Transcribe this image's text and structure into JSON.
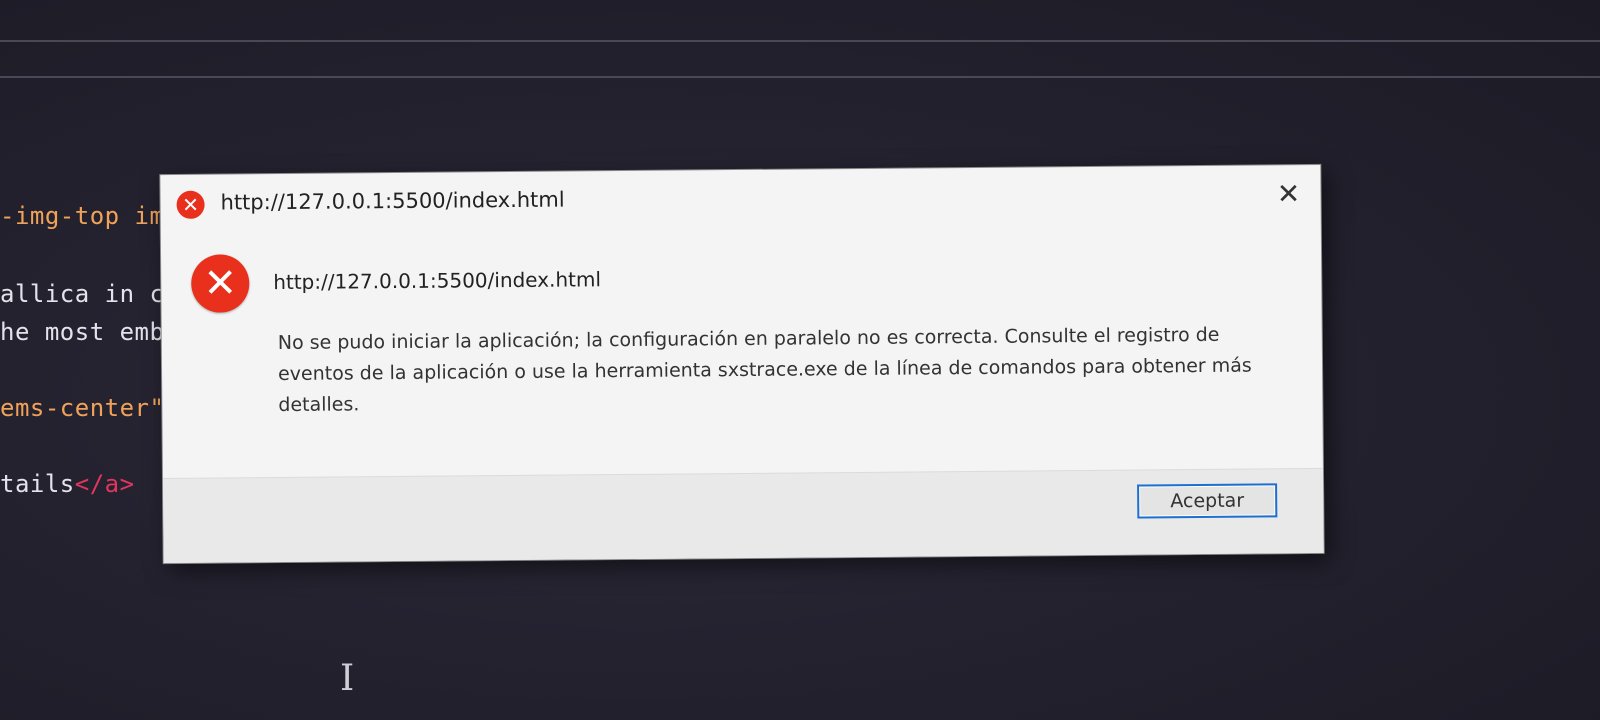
{
  "editor": {
    "lines": [
      {
        "text": "-img-top im",
        "style": "orange"
      },
      {
        "text": "allica in c",
        "style": "plain"
      },
      {
        "text": "he most emb",
        "style": "plain"
      },
      {
        "text": "ems-center\">",
        "style": "orange"
      },
      {
        "text_plain": "tails",
        "text_tag": "</a>"
      }
    ]
  },
  "dialog": {
    "title": "http://127.0.0.1:5500/index.html",
    "title_icon": "error-icon",
    "close_label": "✕",
    "heading": "http://127.0.0.1:5500/index.html",
    "message": "No se pudo iniciar la aplicación; la configuración en paralelo no es correcta. Consulte el registro de eventos de la aplicación o use la herramienta sxstrace.exe de la línea de comandos para obtener más detalles.",
    "ok_label": "Aceptar",
    "colors": {
      "error_red": "#e8301c",
      "focus_blue": "#1f6fd1"
    }
  },
  "cursor": {
    "glyph": "I"
  }
}
